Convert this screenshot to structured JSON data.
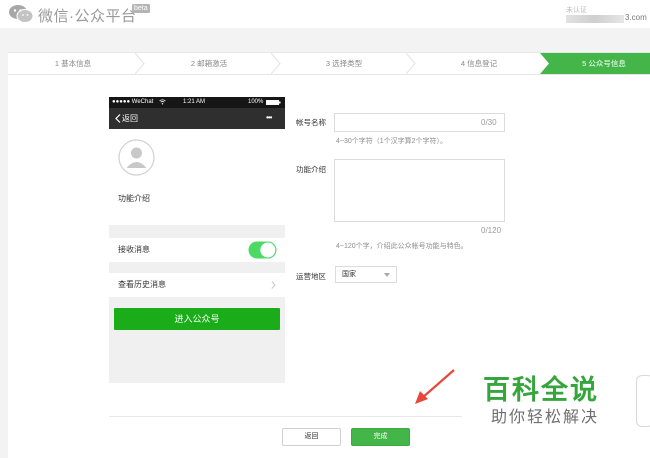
{
  "header": {
    "app_title": "微信·公众平台",
    "beta_badge": "beta",
    "account_line1": "未认证",
    "account_domain_tail": "3.com"
  },
  "steps": [
    {
      "label": "1 基本信息",
      "active": false
    },
    {
      "label": "2 邮箱激活",
      "active": false
    },
    {
      "label": "3 选择类型",
      "active": false
    },
    {
      "label": "4 信息登记",
      "active": false
    },
    {
      "label": "5 公众号信息",
      "active": true
    }
  ],
  "phone": {
    "carrier": "●●●●● WeChat",
    "time": "1:21 AM",
    "battery": "100%",
    "back_label": "返回",
    "more_label": "•••",
    "intro_label": "功能介绍",
    "receive_label": "接收消息",
    "history_label": "查看历史消息",
    "enter_button": "进入公众号"
  },
  "form": {
    "name_label": "帐号名称",
    "name_value": "",
    "name_counter": "0/30",
    "name_hint": "4~30个字符（1个汉字算2个字符）。",
    "intro_label": "功能介绍",
    "intro_value": "",
    "intro_counter": "0/120",
    "intro_hint": "4~120个字，介绍此公众帐号功能与特色。",
    "region_label": "运营地区",
    "region_value": "国家"
  },
  "actions": {
    "back": "返回",
    "done": "完成"
  },
  "watermark": {
    "title": "百科全说",
    "subtitle": "助你轻松解决"
  },
  "colors": {
    "accent_green": "#44b549",
    "button_green": "#1aad19",
    "arrow_red": "#e8463b"
  }
}
